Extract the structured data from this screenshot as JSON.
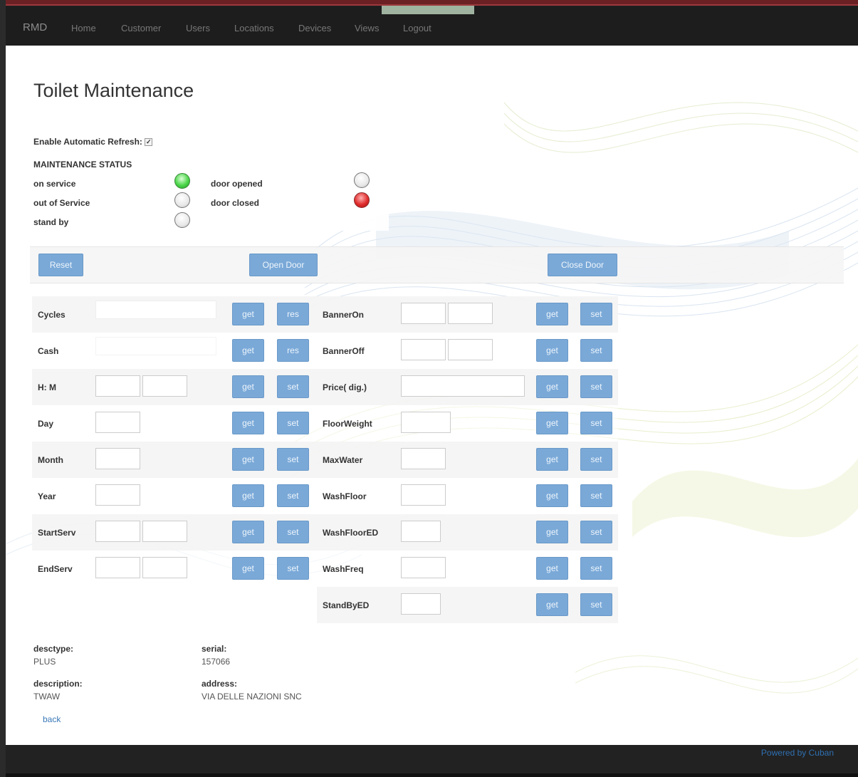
{
  "nav": {
    "brand": "RMD",
    "items": [
      "Home",
      "Customer",
      "Users",
      "Locations",
      "Devices",
      "Views",
      "Logout"
    ]
  },
  "page": {
    "title": "Toilet Maintenance",
    "auto_refresh_label": "Enable Automatic Refresh:",
    "auto_refresh_checked": true
  },
  "status": {
    "title": "MAINTENANCE STATUS",
    "left": [
      {
        "label": "on service",
        "state": "green"
      },
      {
        "label": "out of Service",
        "state": "off"
      },
      {
        "label": "stand by",
        "state": "off"
      }
    ],
    "right": [
      {
        "label": "door opened",
        "state": "off"
      },
      {
        "label": "door closed",
        "state": "red"
      }
    ]
  },
  "actions": {
    "reset": "Reset",
    "open_door": "Open Door",
    "close_door": "Close Door"
  },
  "left_rows": [
    {
      "label": "Cycles",
      "inputs": 1,
      "buttons": [
        "get",
        "res"
      ]
    },
    {
      "label": "Cash",
      "inputs": 1,
      "buttons": [
        "get",
        "res"
      ]
    },
    {
      "label": "H: M",
      "inputs": 2,
      "buttons": [
        "get",
        "set"
      ]
    },
    {
      "label": "Day",
      "inputs": 1,
      "buttons": [
        "get",
        "set"
      ]
    },
    {
      "label": "Month",
      "inputs": 1,
      "buttons": [
        "get",
        "set"
      ]
    },
    {
      "label": "Year",
      "inputs": 1,
      "buttons": [
        "get",
        "set"
      ]
    },
    {
      "label": "StartServ",
      "inputs": 2,
      "buttons": [
        "get",
        "set"
      ]
    },
    {
      "label": "EndServ",
      "inputs": 2,
      "buttons": [
        "get",
        "set"
      ]
    }
  ],
  "right_rows": [
    {
      "label": "BannerOn",
      "inputs": 2,
      "buttons": [
        "get",
        "set"
      ]
    },
    {
      "label": "BannerOff",
      "inputs": 2,
      "buttons": [
        "get",
        "set"
      ]
    },
    {
      "label": "Price( dig.)",
      "inputs": 1,
      "buttons": [
        "get",
        "set"
      ]
    },
    {
      "label": "FloorWeight",
      "inputs": 1,
      "buttons": [
        "get",
        "set"
      ]
    },
    {
      "label": "MaxWater",
      "inputs": 1,
      "buttons": [
        "get",
        "set"
      ]
    },
    {
      "label": "WashFloor",
      "inputs": 1,
      "buttons": [
        "get",
        "set"
      ]
    },
    {
      "label": "WashFloorED",
      "inputs": 1,
      "buttons": [
        "get",
        "set"
      ]
    },
    {
      "label": "WashFreq",
      "inputs": 1,
      "buttons": [
        "get",
        "set"
      ]
    },
    {
      "label": "StandByED",
      "inputs": 1,
      "buttons": [
        "get",
        "set"
      ]
    }
  ],
  "device_info": {
    "desctype_label": "desctype:",
    "desctype_value": "PLUS",
    "serial_label": "serial:",
    "serial_value": "157066",
    "description_label": "description:",
    "description_value": "TWAW",
    "address_label": "address:",
    "address_value": "VIA DELLE NAZIONI SNC"
  },
  "back_link": "back",
  "footer": {
    "powered": "Powered by Cuban"
  }
}
